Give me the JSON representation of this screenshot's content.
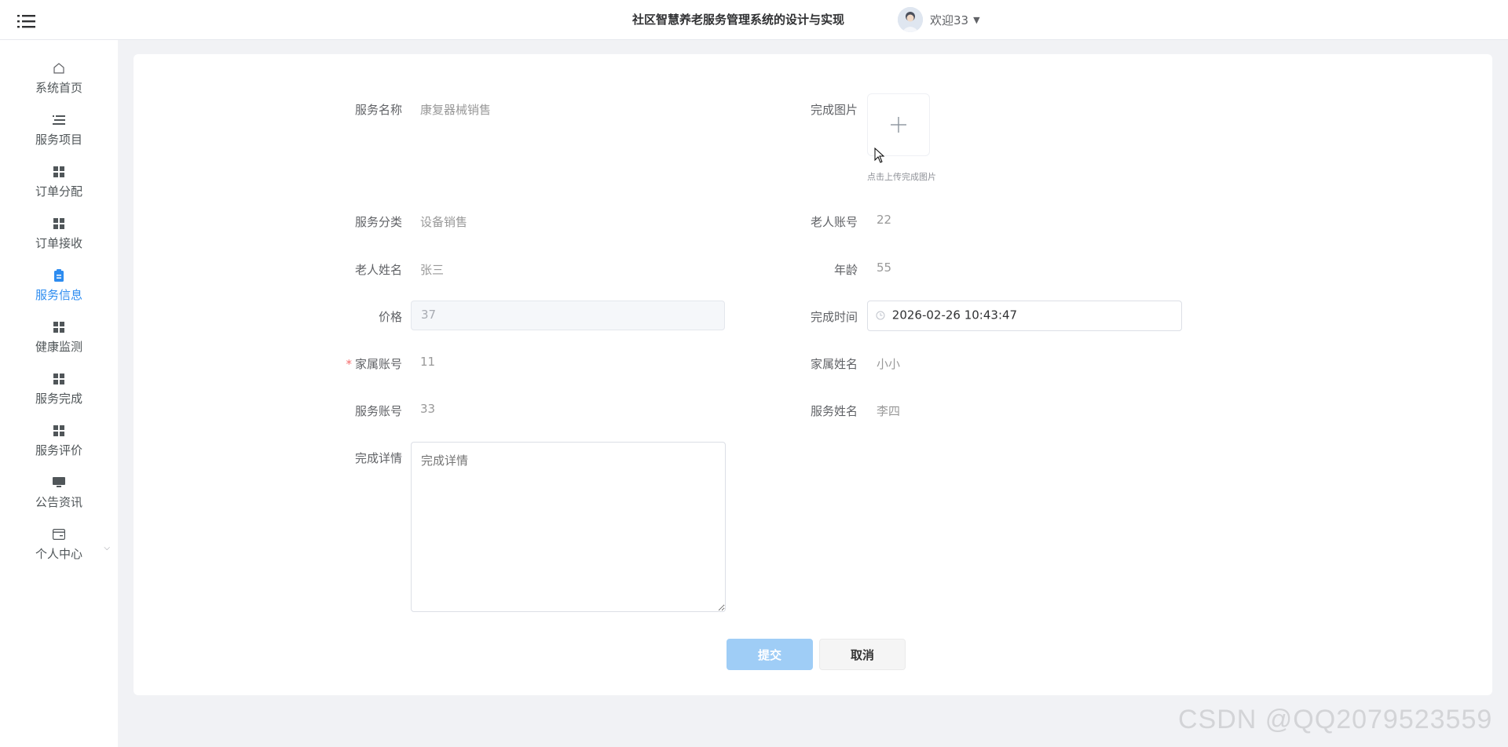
{
  "header": {
    "title": "社区智慧养老服务管理系统的设计与实现",
    "welcome": "欢迎33"
  },
  "sidebar": {
    "items": [
      {
        "label": "系统首页",
        "icon": "home-icon"
      },
      {
        "label": "服务项目",
        "icon": "list-icon"
      },
      {
        "label": "订单分配",
        "icon": "grid-icon"
      },
      {
        "label": "订单接收",
        "icon": "grid-icon"
      },
      {
        "label": "服务信息",
        "icon": "clipboard-icon",
        "active": true
      },
      {
        "label": "健康监测",
        "icon": "grid-icon"
      },
      {
        "label": "服务完成",
        "icon": "grid-icon"
      },
      {
        "label": "服务评价",
        "icon": "grid-icon"
      },
      {
        "label": "公告资讯",
        "icon": "monitor-icon"
      },
      {
        "label": "个人中心",
        "icon": "card-icon"
      }
    ]
  },
  "form": {
    "service_name": {
      "label": "服务名称",
      "value": "康复器械销售"
    },
    "complete_image": {
      "label": "完成图片",
      "tip": "点击上传完成图片"
    },
    "service_category": {
      "label": "服务分类",
      "value": "设备销售"
    },
    "elder_account": {
      "label": "老人账号",
      "value": "22"
    },
    "elder_name": {
      "label": "老人姓名",
      "value": "张三"
    },
    "age": {
      "label": "年龄",
      "value": "55"
    },
    "price": {
      "label": "价格",
      "value": "37"
    },
    "complete_time": {
      "label": "完成时间",
      "value": "2026-02-26 10:43:47"
    },
    "family_account": {
      "label": "家属账号",
      "value": "11",
      "required_mark": "*"
    },
    "family_name": {
      "label": "家属姓名",
      "value": "小小"
    },
    "service_account": {
      "label": "服务账号",
      "value": "33"
    },
    "service_person_name": {
      "label": "服务姓名",
      "value": "李四"
    },
    "complete_detail": {
      "label": "完成详情",
      "placeholder": "完成详情"
    }
  },
  "buttons": {
    "submit": "提交",
    "cancel": "取消"
  },
  "watermark": "CSDN @QQ2079523559",
  "colors": {
    "accent": "#2d8cf0",
    "submit_bg": "#9fcdf6",
    "page_bg": "#f1f2f5"
  }
}
